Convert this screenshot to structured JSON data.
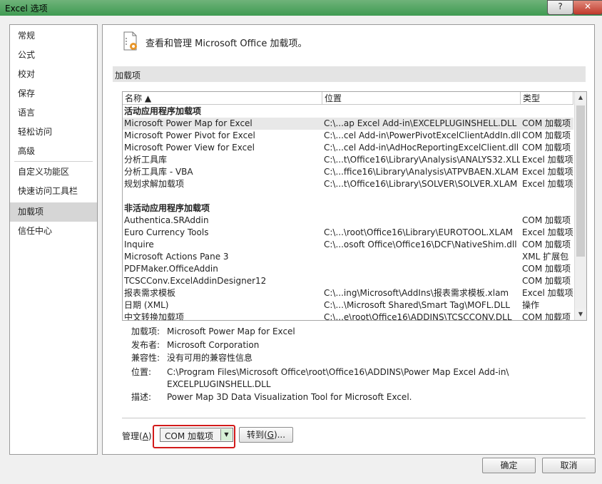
{
  "window": {
    "title": "Excel 选项",
    "help_label": "?",
    "close_label": "✕"
  },
  "nav": {
    "items": [
      "常规",
      "公式",
      "校对",
      "保存",
      "语言",
      "轻松访问",
      "高级",
      "自定义功能区",
      "快速访问工具栏",
      "加载项",
      "信任中心"
    ],
    "selected": "加载项"
  },
  "header": {
    "text": "查看和管理 Microsoft Office 加载项。"
  },
  "section": {
    "title": "加载项"
  },
  "table": {
    "columns": {
      "name": "名称 ▲",
      "location": "位置",
      "type": "类型"
    },
    "active_group": "活动应用程序加载项",
    "active": [
      {
        "name": "Microsoft Power Map for Excel",
        "location": "C:\\...ap Excel Add-in\\EXCELPLUGINSHELL.DLL",
        "type": "COM 加载项"
      },
      {
        "name": "Microsoft Power Pivot for Excel",
        "location": "C:\\...cel Add-in\\PowerPivotExcelClientAddIn.dll",
        "type": "COM 加载项"
      },
      {
        "name": "Microsoft Power View for Excel",
        "location": "C:\\...cel Add-in\\AdHocReportingExcelClient.dll",
        "type": "COM 加载项"
      },
      {
        "name": "分析工具库",
        "location": "C:\\...t\\Office16\\Library\\Analysis\\ANALYS32.XLL",
        "type": "Excel 加载项"
      },
      {
        "name": "分析工具库 - VBA",
        "location": "C:\\...ffice16\\Library\\Analysis\\ATPVBAEN.XLAM",
        "type": "Excel 加载项"
      },
      {
        "name": "规划求解加载项",
        "location": "C:\\...t\\Office16\\Library\\SOLVER\\SOLVER.XLAM",
        "type": "Excel 加载项"
      }
    ],
    "inactive_group": "非活动应用程序加载项",
    "inactive": [
      {
        "name": "Authentica.SRAddin",
        "location": "",
        "type": "COM 加载项"
      },
      {
        "name": "Euro Currency Tools",
        "location": "C:\\...\\root\\Office16\\Library\\EUROTOOL.XLAM",
        "type": "Excel 加载项"
      },
      {
        "name": "Inquire",
        "location": "C:\\...osoft Office\\Office16\\DCF\\NativeShim.dll",
        "type": "COM 加载项"
      },
      {
        "name": "Microsoft Actions Pane 3",
        "location": "",
        "type": "XML 扩展包"
      },
      {
        "name": "PDFMaker.OfficeAddin",
        "location": "",
        "type": "COM 加载项"
      },
      {
        "name": "TCSCConv.ExcelAddinDesigner12",
        "location": "",
        "type": "COM 加载项"
      },
      {
        "name": "报表需求模板",
        "location": "C:\\...ing\\Microsoft\\AddIns\\报表需求模板.xlam",
        "type": "Excel 加载项"
      },
      {
        "name": "日期 (XML)",
        "location": "C:\\...\\Microsoft Shared\\Smart Tag\\MOFL.DLL",
        "type": "操作"
      },
      {
        "name": "中文转换加载项",
        "location": "C:\\...e\\root\\Office16\\ADDINS\\TCSCCONV.DLL",
        "type": "COM 加载项"
      }
    ]
  },
  "details": {
    "addin_label": "加载项:",
    "addin_value": "Microsoft Power Map for Excel",
    "publisher_label": "发布者:",
    "publisher_value": "Microsoft Corporation",
    "compat_label": "兼容性:",
    "compat_value": "没有可用的兼容性信息",
    "location_label": "位置:",
    "location_value_1": "C:\\Program Files\\Microsoft Office\\root\\Office16\\ADDINS\\Power Map Excel Add-in\\",
    "location_value_2": "EXCELPLUGINSHELL.DLL",
    "desc_label": "描述:",
    "desc_value": "Power Map 3D Data Visualization Tool for Microsoft Excel."
  },
  "manage": {
    "label_pre": "管理(",
    "label_key": "A",
    "label_post": "):",
    "selected": "COM 加载项",
    "go_pre": "转到(",
    "go_key": "G",
    "go_post": ")..."
  },
  "buttons": {
    "ok": "确定",
    "cancel": "取消"
  },
  "icons": {
    "help": "help-icon",
    "close": "close-icon",
    "header": "addin-settings-icon",
    "sort": "sort-ascending-icon"
  }
}
